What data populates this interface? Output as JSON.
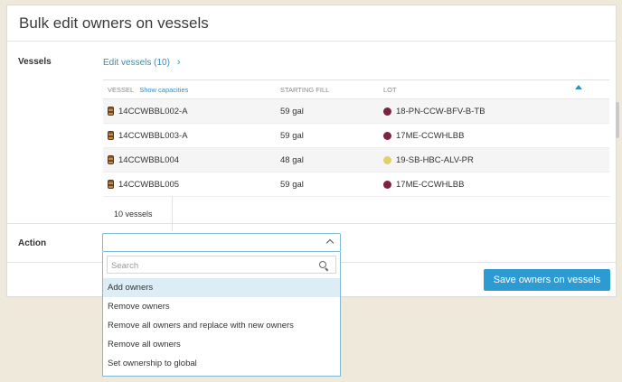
{
  "title": "Bulk edit owners on vessels",
  "vessels": {
    "label": "Vessels",
    "edit_link": "Edit vessels (10)",
    "columns": {
      "vessel": "VESSEL",
      "show_capacities": "Show capacities",
      "starting_fill": "STARTING FILL",
      "lot": "LOT"
    },
    "rows": [
      {
        "vessel": "14CCWBBL002-A",
        "fill": "59 gal",
        "lot": "18-PN-CCW-BFV-B-TB",
        "lot_color": "#7d2244"
      },
      {
        "vessel": "14CCWBBL003-A",
        "fill": "59 gal",
        "lot": "17ME-CCWHLBB",
        "lot_color": "#7d2244"
      },
      {
        "vessel": "14CCWBBL004",
        "fill": "48 gal",
        "lot": "19-SB-HBC-ALV-PR",
        "lot_color": "#e3d06a"
      },
      {
        "vessel": "14CCWBBL005",
        "fill": "59 gal",
        "lot": "17ME-CCWHLBB",
        "lot_color": "#7d2244"
      }
    ],
    "footer_count": "10 vessels"
  },
  "action": {
    "label": "Action",
    "search_placeholder": "Search",
    "options": [
      "Add owners",
      "Remove owners",
      "Remove all owners and replace with new owners",
      "Remove all owners",
      "Set ownership to global"
    ]
  },
  "save_button": "Save owners on vessels"
}
